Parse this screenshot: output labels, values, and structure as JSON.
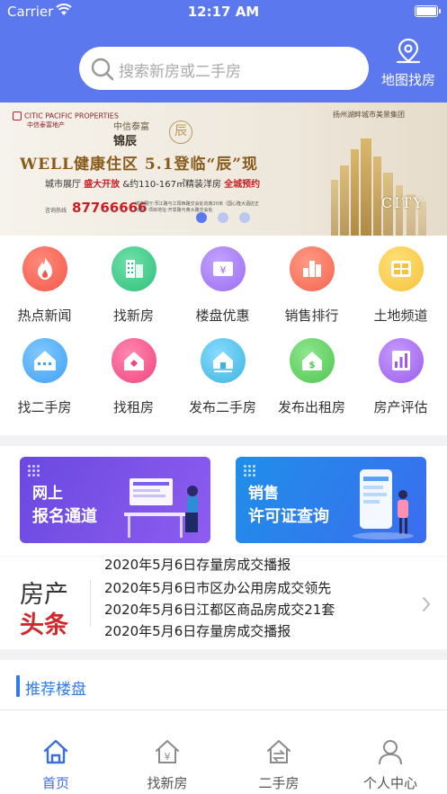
{
  "status": {
    "carrier": "Carrier",
    "time": "12:17 AM"
  },
  "search": {
    "placeholder": "搜索新房或二手房"
  },
  "map_button": {
    "label": "地图找房"
  },
  "banner": {
    "brand": "CITIC PACIFIC PROPERTIES",
    "brand_cn": "中信泰富地产",
    "project_small": "中信泰富",
    "project": "锦辰",
    "circle_char": "辰",
    "right_logo": "扬州湖畔城市美景集团",
    "headline": "WELL健康住区 5.1登临“辰”现",
    "sub_pre": "城市展厅",
    "sub_red1": "盛大开放",
    "sub_mid": "&约110-167㎡精装洋房",
    "sub_red2": "全城预约",
    "phone_label": "咨询热线",
    "phone": "87766666",
    "address": "城市展厅:邗江路与江阳西路交会处向南20米（国心隆大酒店正对面）项目地址:开发路与黄大路交会处",
    "city_text": "CITY",
    "dots": [
      true,
      false,
      false
    ]
  },
  "grid": {
    "items": [
      {
        "label": "热点新闻",
        "icon": "fire-icon",
        "color": "#f2584a"
      },
      {
        "label": "找新房",
        "icon": "building-icon",
        "color": "#2fc07b"
      },
      {
        "label": "楼盘优惠",
        "icon": "coupon-icon",
        "color": "#9b6cf0"
      },
      {
        "label": "销售排行",
        "icon": "ranking-icon",
        "color": "#f5644f"
      },
      {
        "label": "土地频道",
        "icon": "land-grid-icon",
        "color": "#f5c23a"
      },
      {
        "label": "找二手房",
        "icon": "house-icon",
        "color": "#3fa2f1"
      },
      {
        "label": "找租房",
        "icon": "rent-house-icon",
        "color": "#f0447e"
      },
      {
        "label": "发布二手房",
        "icon": "publish-house-icon",
        "color": "#3fb4e0"
      },
      {
        "label": "发布出租房",
        "icon": "publish-rent-icon",
        "color": "#4ec64e"
      },
      {
        "label": "房产评估",
        "icon": "chart-icon",
        "color": "#9b5cea"
      }
    ]
  },
  "promo": {
    "left": {
      "line1": "网上",
      "line2": "报名通道"
    },
    "right": {
      "line1": "销售",
      "line2": "许可证查询"
    }
  },
  "news": {
    "logo_line1": "房产",
    "logo_line2": "头条",
    "items": [
      "2020年5月6日存量房成交播报",
      "2020年5月6日市区办公用房成交领先",
      "2020年5月6日江都区商品房成交21套",
      "2020年5月6日存量房成交播报"
    ]
  },
  "recommended": {
    "title": "推荐楼盘"
  },
  "tabbar": {
    "tabs": [
      {
        "label": "首页",
        "active": true
      },
      {
        "label": "找新房",
        "active": false
      },
      {
        "label": "二手房",
        "active": false
      },
      {
        "label": "个人中心",
        "active": false
      }
    ],
    "active_color": "#3a6de0",
    "inactive_color": "#8a8a8a"
  },
  "colors": {
    "header": "#5b78ef",
    "accent": "#2f7be8"
  }
}
